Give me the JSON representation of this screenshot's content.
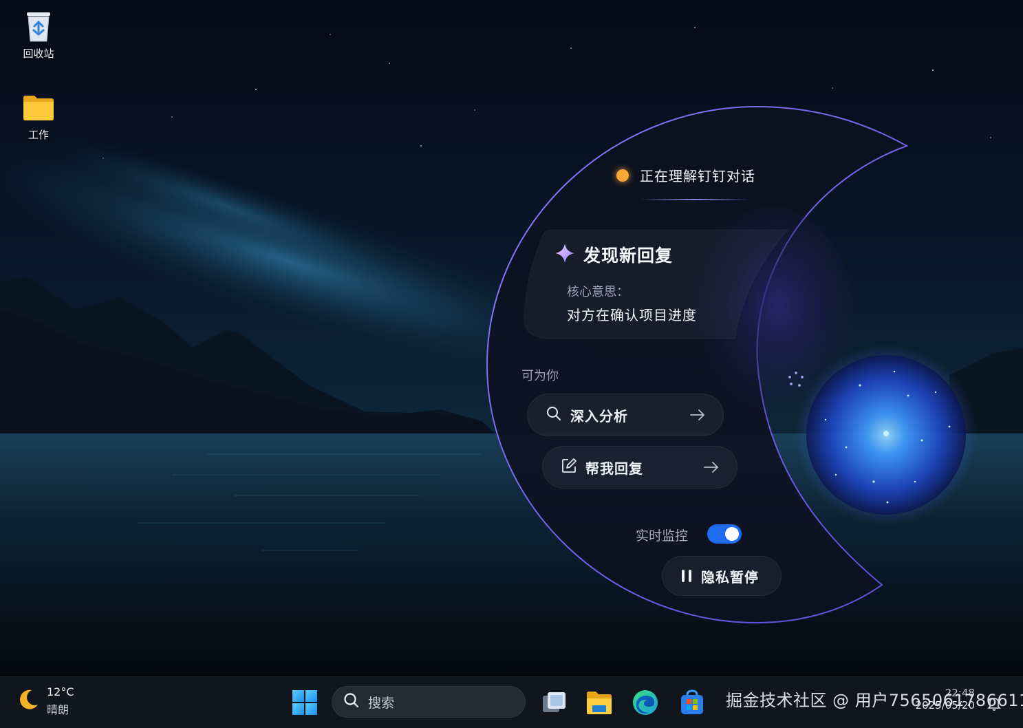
{
  "desktop": {
    "icons": [
      {
        "label": "回收站",
        "icon": "recycle-bin-icon"
      },
      {
        "label": "工作",
        "icon": "folder-icon"
      }
    ]
  },
  "assistant": {
    "status": {
      "text": "正在理解钉钉对话",
      "dot_color": "#f7a838"
    },
    "new_reply": {
      "heading": "发现新回复",
      "core_label": "核心意思：",
      "core_value": "对方在确认项目进度"
    },
    "section_label": "可为你",
    "actions": [
      {
        "label": "深入分析",
        "icon": "search-icon"
      },
      {
        "label": "帮我回复",
        "icon": "edit-icon"
      }
    ],
    "monitor": {
      "label": "实时监控",
      "enabled": true
    },
    "pause_label": "隐私暂停",
    "accent_color": "#7b6cff"
  },
  "taskbar": {
    "weather": {
      "temp": "12°C",
      "condition": "晴朗",
      "icon": "moon-icon"
    },
    "search_placeholder": "搜索",
    "apps": [
      "start-icon",
      "task-view-icon",
      "file-explorer-icon",
      "edge-icon",
      "store-icon"
    ],
    "watermark": "掘金技术社区 @ 用户7565061786611",
    "clock": {
      "time": "22:48",
      "date": "2025/05/20"
    }
  }
}
